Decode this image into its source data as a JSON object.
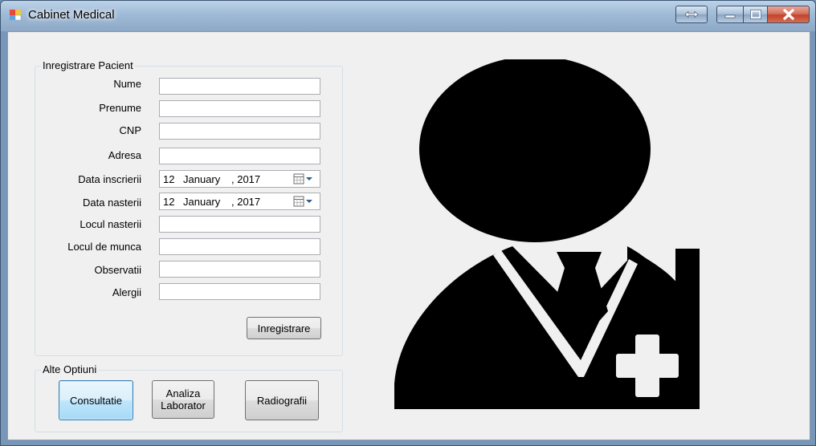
{
  "window": {
    "title": "Cabinet Medical"
  },
  "registration": {
    "group_title": "Inregistrare Pacient",
    "fields": {
      "nume": {
        "label": "Nume",
        "value": ""
      },
      "prenume": {
        "label": "Prenume",
        "value": ""
      },
      "cnp": {
        "label": "CNP",
        "value": ""
      },
      "adresa": {
        "label": "Adresa",
        "value": ""
      },
      "data_inscrierii": {
        "label": "Data inscrierii",
        "day": "12",
        "month": "January",
        "year": ", 2017"
      },
      "data_nasterii": {
        "label": "Data nasterii",
        "day": "12",
        "month": "January",
        "year": ", 2017"
      },
      "locul_nasterii": {
        "label": "Locul nasterii",
        "value": ""
      },
      "locul_de_munca": {
        "label": "Locul de munca",
        "value": ""
      },
      "observatii": {
        "label": "Observatii",
        "value": ""
      },
      "alergii": {
        "label": "Alergii",
        "value": ""
      }
    },
    "submit_label": "Inregistrare"
  },
  "options": {
    "group_title": "Alte Optiuni",
    "consultatie_label": "Consultatie",
    "analiza_line1": "Analiza",
    "analiza_line2": "Laborator",
    "radiografii_label": "Radiografii"
  },
  "icons": {
    "app": "app-window-icon",
    "extra_caption": "double-arrow-icon",
    "minimize": "minimize-icon",
    "maximize": "maximize-icon",
    "close": "close-icon",
    "date_dropdown": "calendar-dropdown-icon",
    "illustration": "doctor-silhouette-icon"
  },
  "colors": {
    "client_bg": "#f0f0f0",
    "silhouette": "#000000",
    "close_button": "#c2432b"
  }
}
